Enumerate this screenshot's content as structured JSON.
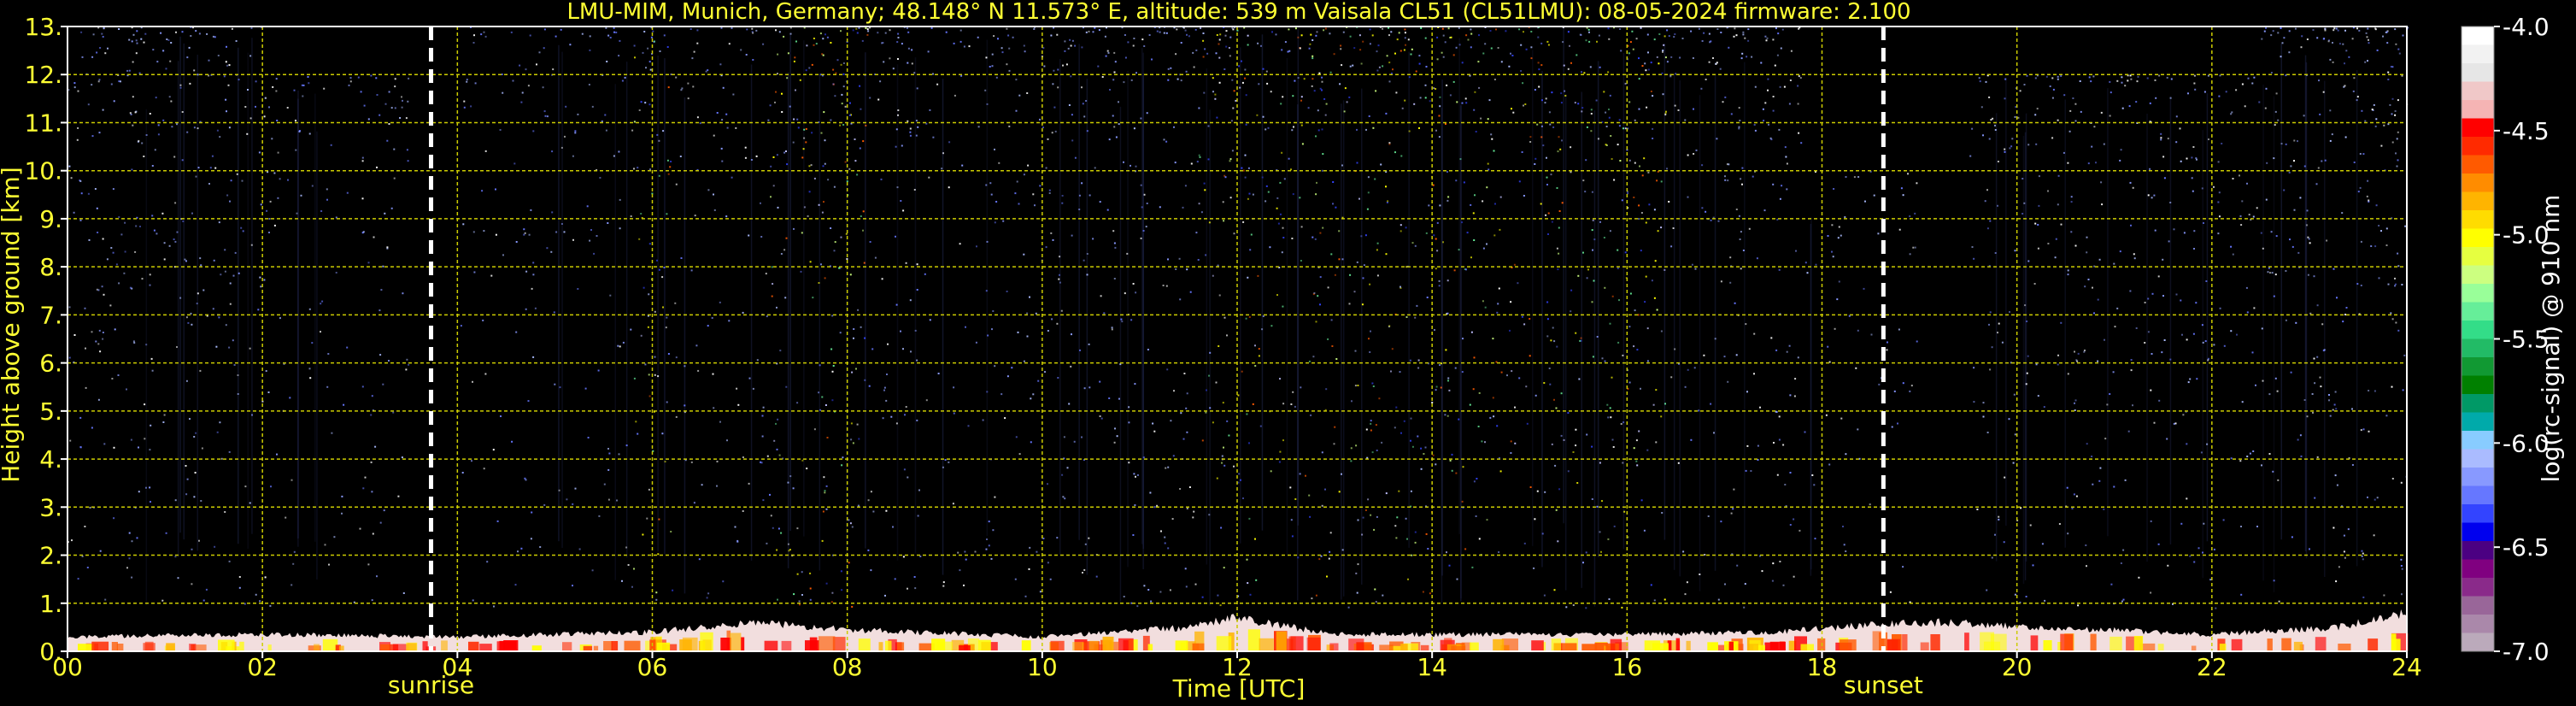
{
  "chart_data": {
    "type": "heatmap",
    "title": "LMU-MIM, Munich, Germany; 48.148° N 11.573° E, altitude: 539 m    Vaisala CL51 (CL51LMU): 08-05-2024    firmware: 2.100",
    "xlabel": "Time [UTC]",
    "ylabel": "Height above ground [km]",
    "xlim": [
      0,
      24
    ],
    "ylim": [
      0,
      13
    ],
    "x_ticks": [
      "00",
      "02",
      "04",
      "06",
      "08",
      "10",
      "12",
      "14",
      "16",
      "18",
      "20",
      "22",
      "24"
    ],
    "y_ticks": [
      "0.",
      "1.",
      "2.",
      "3.",
      "4.",
      "5.",
      "6.",
      "7.",
      "8.",
      "9.",
      "10.",
      "11.",
      "12.",
      "13."
    ],
    "grid": true,
    "annotations": [
      {
        "label": "sunrise",
        "time_utc": 3.73
      },
      {
        "label": "sunset",
        "time_utc": 18.63
      }
    ],
    "colorbar": {
      "label": "log(rc-signal) @ 910 nm",
      "range": [
        -7.0,
        -4.0
      ],
      "tick_labels": [
        "-4.0",
        "-4.5",
        "-5.0",
        "-5.5",
        "-6.0",
        "-6.5",
        "-7.0"
      ],
      "colors": [
        "#ffffff",
        "#f2f2f2",
        "#e6e6e6",
        "#f0c8c8",
        "#f5b4b4",
        "#ff0000",
        "#ff2a00",
        "#ff5a00",
        "#ff8c00",
        "#ffb400",
        "#ffdc00",
        "#ffff00",
        "#e6ff40",
        "#ccff80",
        "#99ff99",
        "#66ee99",
        "#33dd88",
        "#22bb66",
        "#119933",
        "#008000",
        "#009966",
        "#00aaaa",
        "#88ccff",
        "#aabbff",
        "#8899ff",
        "#6677ff",
        "#3344ff",
        "#0000ee",
        "#4b0082",
        "#800080",
        "#8a2a8a",
        "#996699",
        "#aa88aa",
        "#bbaabb"
      ]
    },
    "signal_columns": [
      {
        "start": 0.0,
        "end": 2.0,
        "intensity": 0.55,
        "top_km": 13
      },
      {
        "start": 2.0,
        "end": 3.5,
        "intensity": 0.35,
        "top_km": 12
      },
      {
        "start": 4.0,
        "end": 5.8,
        "intensity": 0.3,
        "top_km": 13
      },
      {
        "start": 5.8,
        "end": 6.2,
        "intensity": 0.65,
        "top_km": 13
      },
      {
        "start": 6.2,
        "end": 7.2,
        "intensity": 0.35,
        "top_km": 13
      },
      {
        "start": 7.2,
        "end": 8.2,
        "intensity": 0.75,
        "top_km": 13
      },
      {
        "start": 8.2,
        "end": 9.5,
        "intensity": 0.4,
        "top_km": 13
      },
      {
        "start": 9.5,
        "end": 11.6,
        "intensity": 0.5,
        "top_km": 13
      },
      {
        "start": 11.6,
        "end": 12.2,
        "intensity": 0.7,
        "top_km": 13
      },
      {
        "start": 12.2,
        "end": 15.5,
        "intensity": 0.65,
        "top_km": 13
      },
      {
        "start": 15.5,
        "end": 16.4,
        "intensity": 0.75,
        "top_km": 13
      },
      {
        "start": 16.4,
        "end": 17.8,
        "intensity": 0.5,
        "top_km": 13
      },
      {
        "start": 17.8,
        "end": 19.0,
        "intensity": 0.25,
        "top_km": 10
      },
      {
        "start": 19.5,
        "end": 22.5,
        "intensity": 0.45,
        "top_km": 12
      },
      {
        "start": 22.5,
        "end": 24.0,
        "intensity": 0.6,
        "top_km": 13
      }
    ],
    "boundary_layer": [
      {
        "t": 0.0,
        "height_km": 0.3
      },
      {
        "t": 2.0,
        "height_km": 0.35
      },
      {
        "t": 4.0,
        "height_km": 0.3
      },
      {
        "t": 6.0,
        "height_km": 0.4
      },
      {
        "t": 7.0,
        "height_km": 0.6
      },
      {
        "t": 8.0,
        "height_km": 0.45
      },
      {
        "t": 10.0,
        "height_km": 0.3
      },
      {
        "t": 11.5,
        "height_km": 0.5
      },
      {
        "t": 12.0,
        "height_km": 0.7
      },
      {
        "t": 13.0,
        "height_km": 0.35
      },
      {
        "t": 16.0,
        "height_km": 0.35
      },
      {
        "t": 17.5,
        "height_km": 0.4
      },
      {
        "t": 18.5,
        "height_km": 0.55
      },
      {
        "t": 19.2,
        "height_km": 0.6
      },
      {
        "t": 22.0,
        "height_km": 0.35
      },
      {
        "t": 23.3,
        "height_km": 0.5
      },
      {
        "t": 24.0,
        "height_km": 0.8
      }
    ]
  }
}
